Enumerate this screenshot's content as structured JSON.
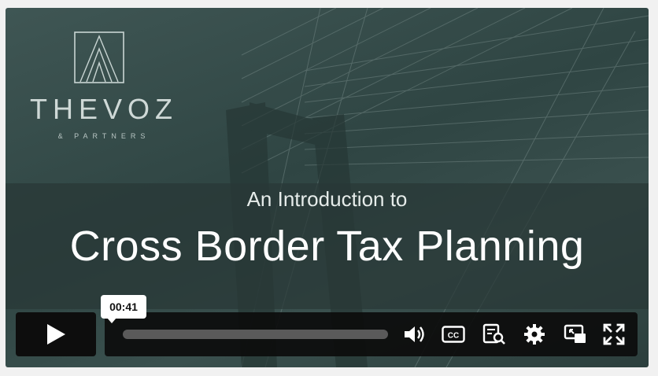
{
  "video": {
    "brand": "THEVOZ",
    "brand_sub": "& PARTNERS",
    "subtitle": "An Introduction to",
    "title": "Cross Border Tax Planning"
  },
  "player": {
    "time_tooltip": "00:41",
    "progress": 0.0,
    "controls": [
      "play-icon",
      "volume-icon",
      "captions-icon",
      "transcript-icon",
      "settings-icon",
      "picture-in-picture-icon",
      "fullscreen-icon"
    ]
  },
  "colors": {
    "overlay": "#2f4543",
    "control_bar": "#0c0c0c",
    "track": "#5a5a5a",
    "icon": "#ffffff"
  }
}
